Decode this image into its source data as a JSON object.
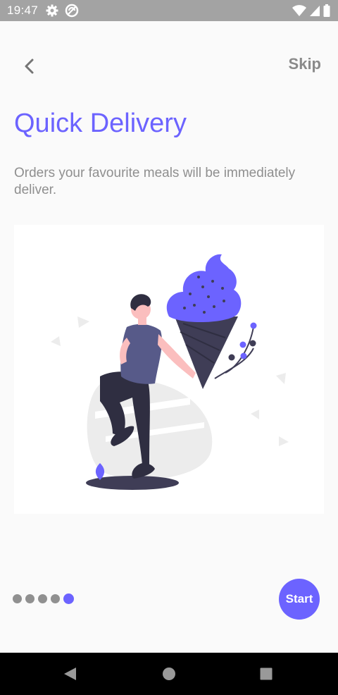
{
  "status_bar": {
    "time": "19:47",
    "icons": [
      "settings-icon",
      "do-not-disturb-icon",
      "wifi-icon",
      "signal-icon",
      "battery-icon"
    ]
  },
  "header": {
    "back_icon": "chevron-left-icon",
    "skip_label": "Skip"
  },
  "content": {
    "title": "Quick Delivery",
    "subtitle": "Orders your favourite meals will be immediately deliver."
  },
  "illustration": {
    "description_icon": "man-with-ice-cream-illustration"
  },
  "pager": {
    "total": 5,
    "active_index": 4
  },
  "actions": {
    "start_label": "Start"
  },
  "nav_bar": {
    "icons": [
      "back-triangle-icon",
      "home-circle-icon",
      "recents-square-icon"
    ]
  },
  "colors": {
    "accent": "#6c63ff",
    "text_muted": "#8f8f8f",
    "status_bar": "#a3a3a3",
    "background": "#fafafa"
  }
}
